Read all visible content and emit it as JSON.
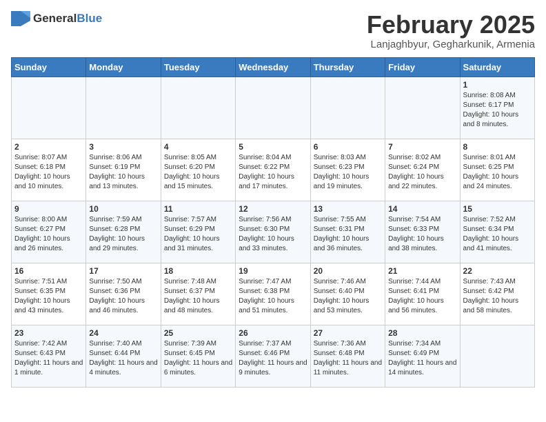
{
  "header": {
    "logo_general": "General",
    "logo_blue": "Blue",
    "title": "February 2025",
    "subtitle": "Lanjaghbyur, Gegharkunik, Armenia"
  },
  "days_of_week": [
    "Sunday",
    "Monday",
    "Tuesday",
    "Wednesday",
    "Thursday",
    "Friday",
    "Saturday"
  ],
  "weeks": [
    [
      {
        "day": "",
        "info": ""
      },
      {
        "day": "",
        "info": ""
      },
      {
        "day": "",
        "info": ""
      },
      {
        "day": "",
        "info": ""
      },
      {
        "day": "",
        "info": ""
      },
      {
        "day": "",
        "info": ""
      },
      {
        "day": "1",
        "info": "Sunrise: 8:08 AM\nSunset: 6:17 PM\nDaylight: 10 hours and 8 minutes."
      }
    ],
    [
      {
        "day": "2",
        "info": "Sunrise: 8:07 AM\nSunset: 6:18 PM\nDaylight: 10 hours and 10 minutes."
      },
      {
        "day": "3",
        "info": "Sunrise: 8:06 AM\nSunset: 6:19 PM\nDaylight: 10 hours and 13 minutes."
      },
      {
        "day": "4",
        "info": "Sunrise: 8:05 AM\nSunset: 6:20 PM\nDaylight: 10 hours and 15 minutes."
      },
      {
        "day": "5",
        "info": "Sunrise: 8:04 AM\nSunset: 6:22 PM\nDaylight: 10 hours and 17 minutes."
      },
      {
        "day": "6",
        "info": "Sunrise: 8:03 AM\nSunset: 6:23 PM\nDaylight: 10 hours and 19 minutes."
      },
      {
        "day": "7",
        "info": "Sunrise: 8:02 AM\nSunset: 6:24 PM\nDaylight: 10 hours and 22 minutes."
      },
      {
        "day": "8",
        "info": "Sunrise: 8:01 AM\nSunset: 6:25 PM\nDaylight: 10 hours and 24 minutes."
      }
    ],
    [
      {
        "day": "9",
        "info": "Sunrise: 8:00 AM\nSunset: 6:27 PM\nDaylight: 10 hours and 26 minutes."
      },
      {
        "day": "10",
        "info": "Sunrise: 7:59 AM\nSunset: 6:28 PM\nDaylight: 10 hours and 29 minutes."
      },
      {
        "day": "11",
        "info": "Sunrise: 7:57 AM\nSunset: 6:29 PM\nDaylight: 10 hours and 31 minutes."
      },
      {
        "day": "12",
        "info": "Sunrise: 7:56 AM\nSunset: 6:30 PM\nDaylight: 10 hours and 33 minutes."
      },
      {
        "day": "13",
        "info": "Sunrise: 7:55 AM\nSunset: 6:31 PM\nDaylight: 10 hours and 36 minutes."
      },
      {
        "day": "14",
        "info": "Sunrise: 7:54 AM\nSunset: 6:33 PM\nDaylight: 10 hours and 38 minutes."
      },
      {
        "day": "15",
        "info": "Sunrise: 7:52 AM\nSunset: 6:34 PM\nDaylight: 10 hours and 41 minutes."
      }
    ],
    [
      {
        "day": "16",
        "info": "Sunrise: 7:51 AM\nSunset: 6:35 PM\nDaylight: 10 hours and 43 minutes."
      },
      {
        "day": "17",
        "info": "Sunrise: 7:50 AM\nSunset: 6:36 PM\nDaylight: 10 hours and 46 minutes."
      },
      {
        "day": "18",
        "info": "Sunrise: 7:48 AM\nSunset: 6:37 PM\nDaylight: 10 hours and 48 minutes."
      },
      {
        "day": "19",
        "info": "Sunrise: 7:47 AM\nSunset: 6:38 PM\nDaylight: 10 hours and 51 minutes."
      },
      {
        "day": "20",
        "info": "Sunrise: 7:46 AM\nSunset: 6:40 PM\nDaylight: 10 hours and 53 minutes."
      },
      {
        "day": "21",
        "info": "Sunrise: 7:44 AM\nSunset: 6:41 PM\nDaylight: 10 hours and 56 minutes."
      },
      {
        "day": "22",
        "info": "Sunrise: 7:43 AM\nSunset: 6:42 PM\nDaylight: 10 hours and 58 minutes."
      }
    ],
    [
      {
        "day": "23",
        "info": "Sunrise: 7:42 AM\nSunset: 6:43 PM\nDaylight: 11 hours and 1 minute."
      },
      {
        "day": "24",
        "info": "Sunrise: 7:40 AM\nSunset: 6:44 PM\nDaylight: 11 hours and 4 minutes."
      },
      {
        "day": "25",
        "info": "Sunrise: 7:39 AM\nSunset: 6:45 PM\nDaylight: 11 hours and 6 minutes."
      },
      {
        "day": "26",
        "info": "Sunrise: 7:37 AM\nSunset: 6:46 PM\nDaylight: 11 hours and 9 minutes."
      },
      {
        "day": "27",
        "info": "Sunrise: 7:36 AM\nSunset: 6:48 PM\nDaylight: 11 hours and 11 minutes."
      },
      {
        "day": "28",
        "info": "Sunrise: 7:34 AM\nSunset: 6:49 PM\nDaylight: 11 hours and 14 minutes."
      },
      {
        "day": "",
        "info": ""
      }
    ]
  ]
}
